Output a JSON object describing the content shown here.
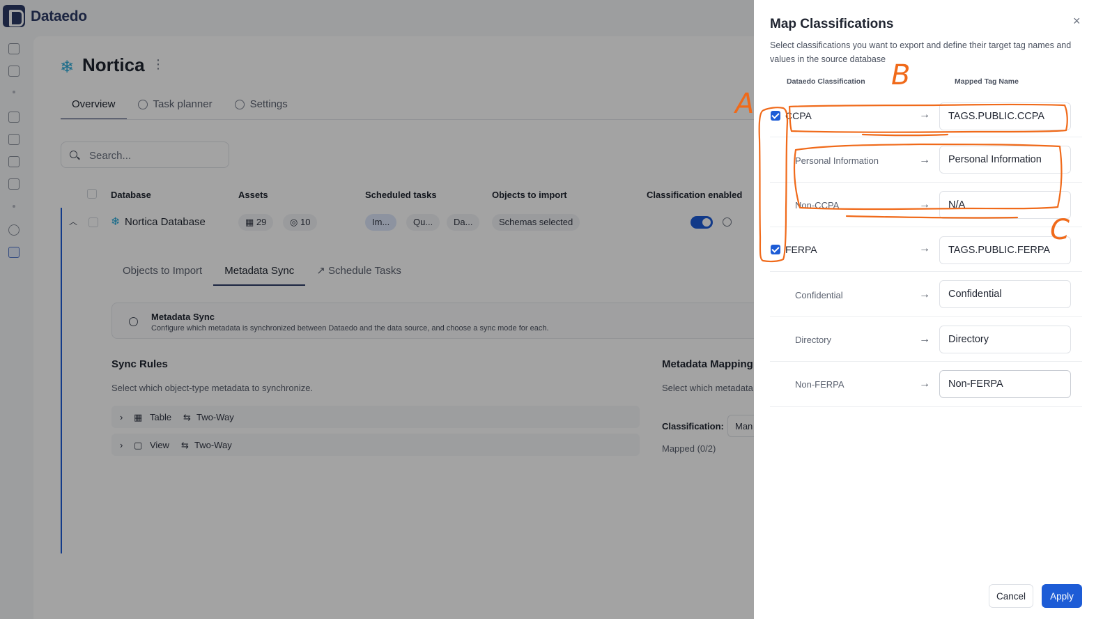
{
  "app": {
    "brand": "Dataedo",
    "project_title": "Nortica",
    "tabs": [
      {
        "label": "Overview"
      },
      {
        "label": "Task planner"
      },
      {
        "label": "Settings"
      }
    ],
    "search_placeholder": "Search...",
    "table": {
      "headers": [
        "Database",
        "Assets",
        "Scheduled tasks",
        "Objects to import",
        "Classification enabled"
      ],
      "row": {
        "name": "Nortica Database",
        "assets_tables": "29",
        "assets_other": "10",
        "tasks": [
          "Im...",
          "Qu...",
          "Da..."
        ],
        "objects": "Schemas selected"
      }
    },
    "subtabs": [
      {
        "label": "Objects to Import"
      },
      {
        "label": "Metadata Sync"
      },
      {
        "label": "Schedule Tasks"
      }
    ],
    "info": {
      "title": "Metadata Sync",
      "text": "Configure which metadata is synchronized between Dataedo and the data source, and choose a sync mode for each."
    },
    "sync_rules": {
      "title": "Sync Rules",
      "subtitle": "Select which object-type metadata to synchronize.",
      "rows": [
        {
          "object": "Table",
          "mode": "Two-Way"
        },
        {
          "object": "View",
          "mode": "Two-Way"
        }
      ]
    },
    "metadata_mapping": {
      "title": "Metadata Mapping",
      "subtitle": "Select which metadata",
      "classification_label": "Classification:",
      "classification_value": "Man",
      "mapped": "Mapped (0/2)"
    }
  },
  "modal": {
    "title": "Map Classifications",
    "close": "×",
    "description": "Select classifications you want to export and define their target tag names and values in the source database",
    "col_left": "Dataedo Classification",
    "col_right": "Mapped Tag Name",
    "arrow": "→",
    "rows": [
      {
        "kind": "classification",
        "checked": true,
        "name": "CCPA",
        "value": "TAGS.PUBLIC.CCPA"
      },
      {
        "kind": "value",
        "name": "Personal Information",
        "value": "Personal Information"
      },
      {
        "kind": "value",
        "name": "Non-CCPA",
        "value": "N/A"
      },
      {
        "kind": "classification",
        "checked": true,
        "name": "FERPA",
        "value": "TAGS.PUBLIC.FERPA"
      },
      {
        "kind": "value",
        "name": "Confidential",
        "value": "Confidential"
      },
      {
        "kind": "value",
        "name": "Directory",
        "value": "Directory"
      },
      {
        "kind": "value",
        "name": "Non-FERPA",
        "value": "Non-FERPA"
      }
    ],
    "cancel": "Cancel",
    "apply": "Apply"
  },
  "annotations": {
    "letters": [
      "A",
      "B",
      "C"
    ],
    "color": "#f06a1a"
  },
  "colors": {
    "accent": "#1d5cd6",
    "brand": "#2c3a66",
    "snowflake": "#2aa9d8"
  }
}
